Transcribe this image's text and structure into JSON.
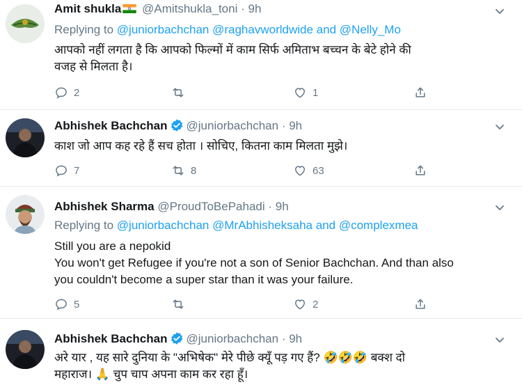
{
  "icons": {
    "reply": "reply-icon",
    "retweet": "retweet-icon",
    "like": "heart-icon",
    "share": "share-icon",
    "more": "chevron-down-icon",
    "verified": "verified-badge-icon",
    "flag": "india-flag-emoji"
  },
  "colors": {
    "link": "#1da1f2",
    "muted": "#657786",
    "text": "#14171a",
    "verified": "#1da1f2"
  },
  "tweets": [
    {
      "name": "Amit shukla",
      "handle": "@Amitshukla_toni",
      "dot": "·",
      "time": "9h",
      "reply_prefix": "Replying to",
      "reply_to": [
        "@juniorbachchan",
        "@raghavworldwide",
        "and",
        "@Nelly_Mo"
      ],
      "text_lines": [
        "आपको नहीं लगता है कि आपको फिल्मों में काम सिर्फ अमिताभ बच्चन के बेटे होने की",
        "वजह से मिलता है।"
      ],
      "replies": "2",
      "retweets": "",
      "likes": "1"
    },
    {
      "name": "Abhishek Bachchan",
      "handle": "@juniorbachchan",
      "dot": "·",
      "time": "9h",
      "text_lines": [
        "काश जो आप कह रहे हैं सच होता । सोचिए, कितना काम मिलता मुझे।"
      ],
      "replies": "7",
      "retweets": "8",
      "likes": "63"
    },
    {
      "name": "Abhishek Sharma",
      "handle": "@ProudToBePahadi",
      "dot": "·",
      "time": "9h",
      "reply_prefix": "Replying to",
      "reply_to": [
        "@juniorbachchan",
        "@MrAbhisheksaha",
        "and",
        "@complexmea"
      ],
      "text_lines": [
        "Still you are a nepokid",
        "You won't get Refugee if you're not a son of Senior Bachchan. And than also",
        "you couldn't become a super star than it was your failure."
      ],
      "replies": "5",
      "retweets": "",
      "likes": "2"
    },
    {
      "name": "Abhishek Bachchan",
      "handle": "@juniorbachchan",
      "dot": "·",
      "time": "9h",
      "text_lines": [
        "अरे यार , यह सारे दुनिया के \"अभिषेक\" मेरे पीछे क्यूँ पड़ गए हैं? 🤣🤣🤣 बक्श दो",
        "महाराज। 🙏 चुप चाप अपना काम कर रहा हूँ।"
      ]
    }
  ]
}
